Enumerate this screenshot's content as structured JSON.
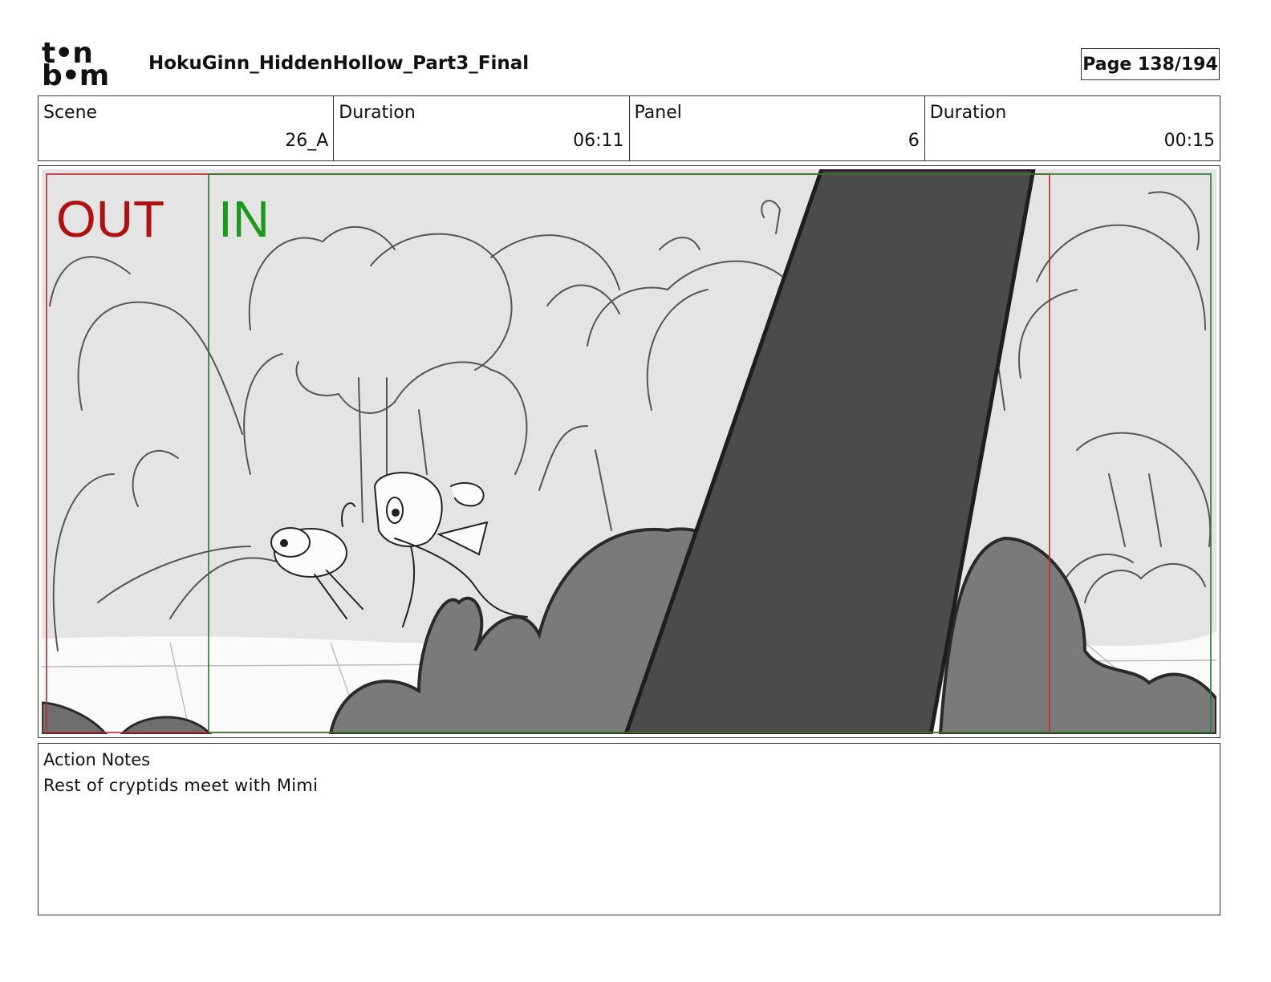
{
  "header": {
    "logo_line1": "t•n",
    "logo_line2": "b•m",
    "title": "HokuGinn_HiddenHollow_Part3_Final",
    "page": "Page 138/194"
  },
  "info": {
    "scene_label": "Scene",
    "scene_value": "26_A",
    "scene_duration_label": "Duration",
    "scene_duration_value": "06:11",
    "panel_label": "Panel",
    "panel_value": "6",
    "panel_duration_label": "Duration",
    "panel_duration_value": "00:15"
  },
  "panel": {
    "out_label": "OUT",
    "in_label": "IN",
    "out_color": "#b01010",
    "in_color": "#1a9a1a"
  },
  "notes": {
    "label": "Action Notes",
    "text": "Rest of cryptids meet with Mimi"
  }
}
